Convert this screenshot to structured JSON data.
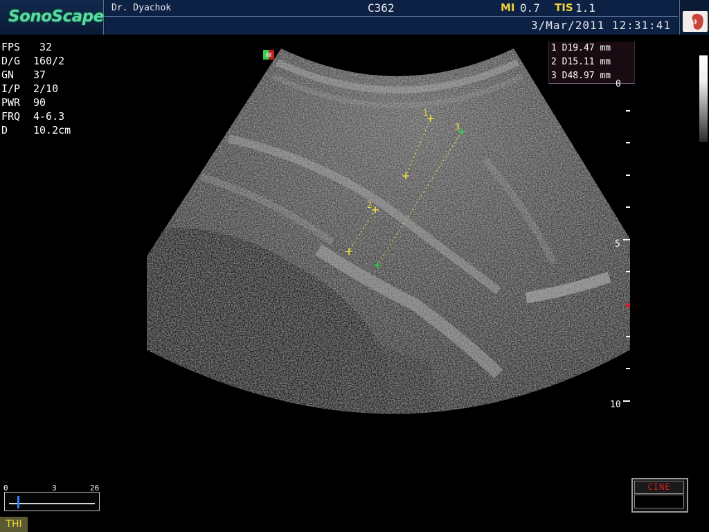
{
  "header": {
    "logo": "SonoScape",
    "doctor": "Dr. Dyachok",
    "probe": "C362",
    "mi_label": "MI",
    "mi_value": "0.7",
    "tis_label": "TIS",
    "tis_value": "1.1",
    "datetime": "3/Mar/2011 12:31:41",
    "organ_icon": "kidney-icon"
  },
  "params": [
    {
      "label": "FPS",
      "value": " 32"
    },
    {
      "label": "D/G",
      "value": "160/2"
    },
    {
      "label": "GN",
      "value": "37"
    },
    {
      "label": "I/P",
      "value": "2/10"
    },
    {
      "label": "PWR",
      "value": "90"
    },
    {
      "label": "FRQ",
      "value": "4-6.3"
    },
    {
      "label": "D",
      "value": "10.2cm"
    }
  ],
  "measurements": [
    {
      "text": "1 D19.47 mm"
    },
    {
      "text": "2 D15.11 mm"
    },
    {
      "text": "3 D48.97 mm"
    }
  ],
  "depth_scale": {
    "labels": [
      "0",
      "5",
      "10"
    ]
  },
  "calipers": {
    "labels": [
      "1",
      "2",
      "3"
    ],
    "colors": {
      "yellow": "#f0e040",
      "green": "#2fd24a"
    }
  },
  "cine_slider": {
    "min": "0",
    "mid": "3",
    "max": "26"
  },
  "badges": {
    "thi": "THI",
    "cine": "CINE"
  },
  "colors": {
    "header_bg": "#0d2145",
    "accent_yellow": "#f0d23c",
    "logo_green": "#5fd6a6",
    "cine_red": "#e02020"
  }
}
